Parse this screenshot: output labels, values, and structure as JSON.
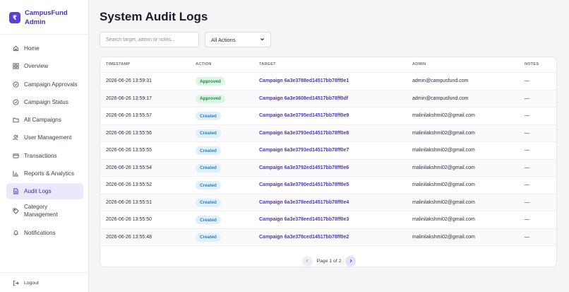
{
  "app": {
    "brand_line1": "CampusFund",
    "brand_line2": "Admin",
    "logo_glyph": "₹"
  },
  "sidebar": {
    "items": [
      {
        "label": "Home",
        "icon": "home-icon"
      },
      {
        "label": "Overview",
        "icon": "grid-icon"
      },
      {
        "label": "Campaign Approvals",
        "icon": "check-circle-icon"
      },
      {
        "label": "Campaign Status",
        "icon": "check-circle-icon"
      },
      {
        "label": "All Campaigns",
        "icon": "folder-icon"
      },
      {
        "label": "User Management",
        "icon": "users-icon"
      },
      {
        "label": "Transactions",
        "icon": "card-icon"
      },
      {
        "label": "Reports & Analytics",
        "icon": "bar-chart-icon"
      },
      {
        "label": "Audit Logs",
        "icon": "document-icon",
        "active": true
      },
      {
        "label": "Category Management",
        "label_line1": "Category",
        "label_line2": "Management",
        "icon": "tag-icon"
      },
      {
        "label": "Notifications",
        "icon": "bell-icon"
      }
    ],
    "logout_label": "Logout"
  },
  "main": {
    "title": "System Audit Logs",
    "search_placeholder": "Search target, admin or notes...",
    "filter_value": "All Actions"
  },
  "table": {
    "columns": [
      "TIMESTAMP",
      "ACTION",
      "TARGET",
      "ADMIN",
      "NOTES"
    ],
    "rows": [
      {
        "timestamp": "2026-06-26 13:59:31",
        "action": "Approved",
        "target": "Campaign 6a3e3788ed14517bb78ff0e1",
        "admin": "admin@campusfund.com",
        "notes": "—"
      },
      {
        "timestamp": "2026-06-26 13:59:17",
        "action": "Approved",
        "target": "Campaign 6a3e3608ed14517bb78ff0df",
        "admin": "admin@campusfund.com",
        "notes": "—"
      },
      {
        "timestamp": "2026-06-26 13:55:57",
        "action": "Created",
        "target": "Campaign 6a3e3795ed14517bb78ff0e9",
        "admin": "malinilakshmi02@gmail.com",
        "notes": "—"
      },
      {
        "timestamp": "2026-06-26 13:55:56",
        "action": "Created",
        "target": "Campaign 6a3e3793ed14517bb78ff0e8",
        "admin": "malinilakshmi02@gmail.com",
        "notes": "—"
      },
      {
        "timestamp": "2026-06-26 13:55:55",
        "action": "Created",
        "target": "Campaign 6a3e3793ed14517bb78ff0e7",
        "admin": "malinilakshmi02@gmail.com",
        "notes": "—"
      },
      {
        "timestamp": "2026-06-26 13:55:54",
        "action": "Created",
        "target": "Campaign 6a3e3792ed14517bb78ff0e6",
        "admin": "malinilakshmi02@gmail.com",
        "notes": "—"
      },
      {
        "timestamp": "2026-06-26 13:55:52",
        "action": "Created",
        "target": "Campaign 6a3e3790ed14517bb78ff0e5",
        "admin": "malinilakshmi02@gmail.com",
        "notes": "—"
      },
      {
        "timestamp": "2026-06-26 13:55:51",
        "action": "Created",
        "target": "Campaign 6a3e378eed14517bb78ff0e4",
        "admin": "malinilakshmi02@gmail.com",
        "notes": "—"
      },
      {
        "timestamp": "2026-06-26 13:55:50",
        "action": "Created",
        "target": "Campaign 6a3e378eed14517bb78ff0e3",
        "admin": "malinilakshmi02@gmail.com",
        "notes": "—"
      },
      {
        "timestamp": "2026-06-26 13:55:48",
        "action": "Created",
        "target": "Campaign 6a3e378ced14517bb78ff0e2",
        "admin": "malinilakshmi02@gmail.com",
        "notes": "—"
      }
    ]
  },
  "pagination": {
    "label": "Page 1 of 2"
  },
  "colors": {
    "accent": "#4b35c7",
    "approved": "#1f8a45",
    "created": "#2a7fc0"
  }
}
